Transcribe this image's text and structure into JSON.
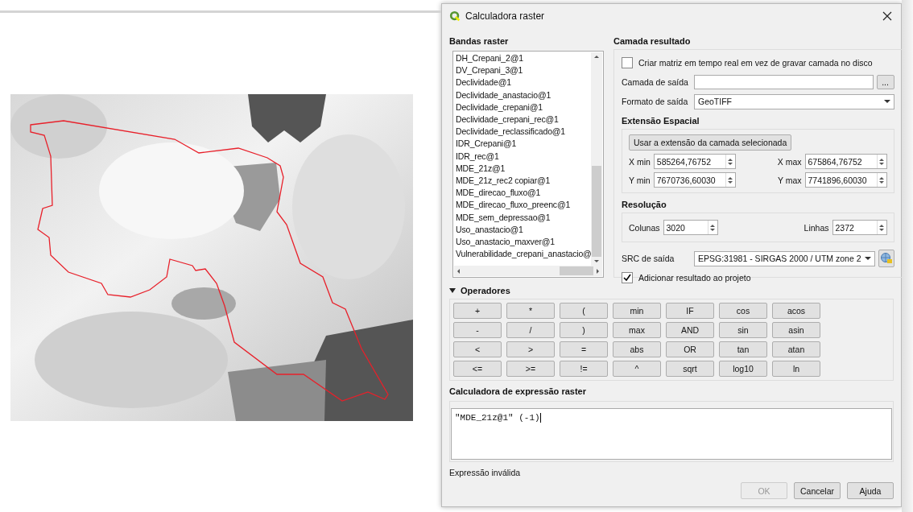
{
  "window": {
    "title": "Calculadora raster"
  },
  "bands": {
    "title": "Bandas raster",
    "items": [
      {
        "label": "DH_Crepani_2@1",
        "selected": false
      },
      {
        "label": "DV_Crepani_3@1",
        "selected": false
      },
      {
        "label": "Declividade@1",
        "selected": false
      },
      {
        "label": "Declividade_anastacio@1",
        "selected": false
      },
      {
        "label": "Declividade_crepani@1",
        "selected": false
      },
      {
        "label": "Declividade_crepani_rec@1",
        "selected": false
      },
      {
        "label": "Declividade_reclassificado@1",
        "selected": false
      },
      {
        "label": "IDR_Crepani@1",
        "selected": false
      },
      {
        "label": "IDR_rec@1",
        "selected": false
      },
      {
        "label": "MDE_21z@1",
        "selected": false
      },
      {
        "label": "MDE_21z_rec2  copiar@1",
        "selected": false
      },
      {
        "label": "MDE_direcao_fluxo@1",
        "selected": false
      },
      {
        "label": "MDE_direcao_fluxo_preenc@1",
        "selected": false
      },
      {
        "label": "MDE_sem_depressao@1",
        "selected": false
      },
      {
        "label": "Uso_anastacio@1",
        "selected": false
      },
      {
        "label": "Uso_anastacio_maxver@1",
        "selected": false
      },
      {
        "label": "Vulnerabilidade_crepani_anastacio@",
        "selected": false
      }
    ]
  },
  "result": {
    "title": "Camada resultado",
    "realtime": {
      "label": "Criar matriz em tempo real em vez de gravar camada no disco",
      "checked": false
    },
    "output_layer": {
      "label": "Camada de saída",
      "browse": "..."
    },
    "format": {
      "label": "Formato de saída",
      "value": "GeoTIFF"
    },
    "extent": {
      "title": "Extensão Espacial",
      "button": "Usar a extensão da camada selecionada",
      "fields": [
        {
          "label": "X min",
          "value": "585264,76752"
        },
        {
          "label": "X max",
          "value": "675864,76752"
        },
        {
          "label": "Y min",
          "value": "7670736,60030"
        },
        {
          "label": "Y max",
          "value": "7741896,60030"
        }
      ]
    },
    "resolution": {
      "title": "Resolução",
      "fields": [
        {
          "label": "Colunas",
          "value": "3020"
        },
        {
          "label": "Linhas",
          "value": "2372"
        }
      ]
    },
    "crs": {
      "label": "SRC de saída",
      "value": "EPSG:31981 - SIRGAS 2000 / UTM zone 2"
    },
    "add_to_project": {
      "label": "Adicionar resultado ao projeto",
      "checked": true
    }
  },
  "operators": {
    "title": "Operadores",
    "expanded": true,
    "rows": [
      [
        "+",
        "*",
        "(",
        "min",
        "IF",
        "cos",
        "acos"
      ],
      [
        "-",
        "/",
        ")",
        "max",
        "AND",
        "sin",
        "asin"
      ],
      [
        "<",
        ">",
        "=",
        "abs",
        "OR",
        "tan",
        "atan"
      ],
      [
        "<=",
        ">=",
        "!=",
        "^",
        "sqrt",
        "log10",
        "ln"
      ]
    ]
  },
  "expression": {
    "title": "Calculadora de expressão raster",
    "value": "\"MDE_21z@1\" (-1)"
  },
  "status": "Expressão inválida",
  "buttons": [
    {
      "label": "OK",
      "disabled": true
    },
    {
      "label": "Cancelar",
      "disabled": false
    },
    {
      "label": "Ajuda",
      "disabled": false
    }
  ]
}
